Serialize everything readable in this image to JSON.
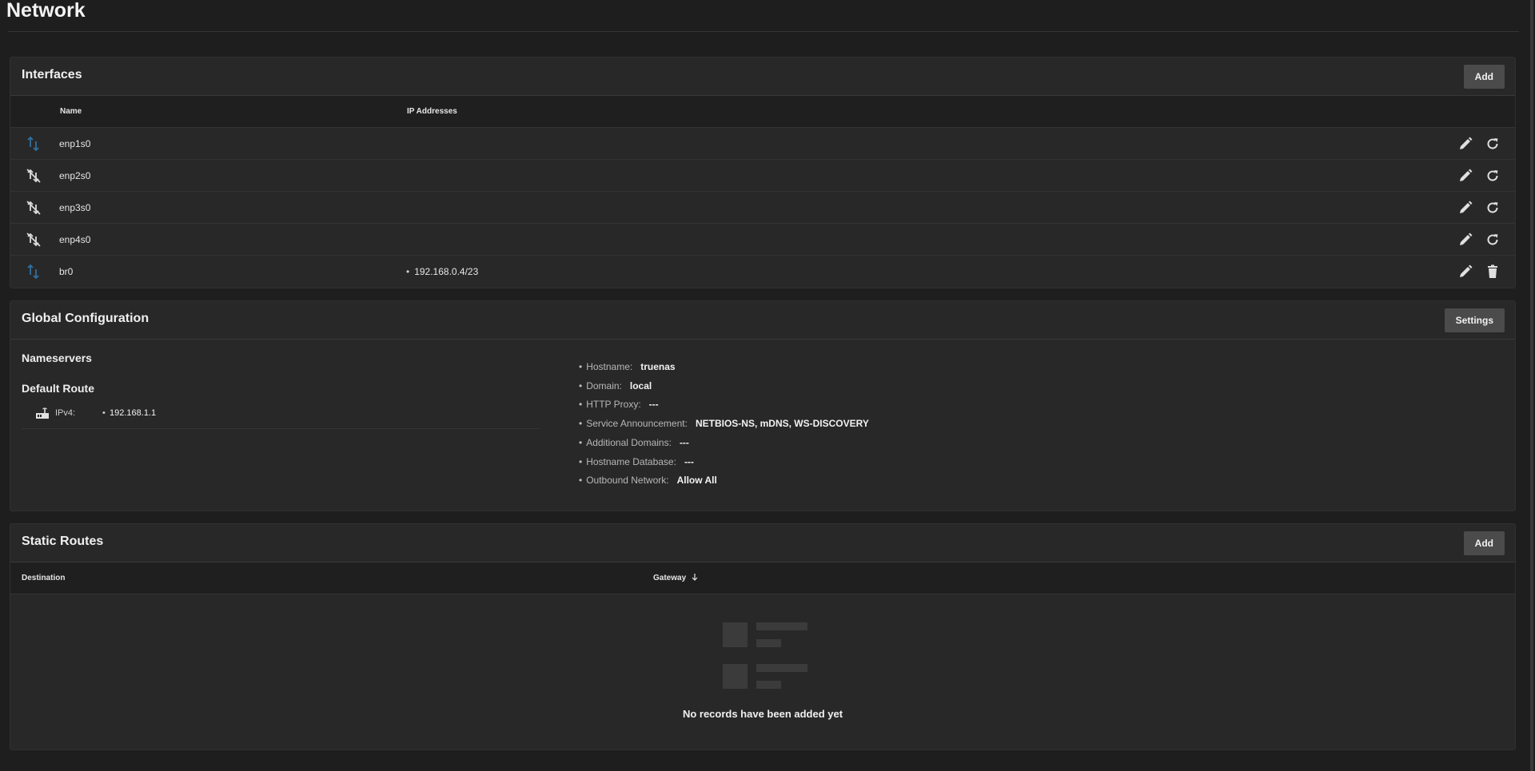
{
  "page": {
    "title": "Network"
  },
  "interfaces": {
    "title": "Interfaces",
    "add_label": "Add",
    "columns": {
      "name": "Name",
      "ip": "IP Addresses"
    },
    "rows": [
      {
        "name": "enp1s0",
        "ip": "",
        "status": "link-up-icon",
        "action2": "refresh-icon"
      },
      {
        "name": "enp2s0",
        "ip": "",
        "status": "link-down-icon",
        "action2": "refresh-icon"
      },
      {
        "name": "enp3s0",
        "ip": "",
        "status": "link-down-icon",
        "action2": "refresh-icon"
      },
      {
        "name": "enp4s0",
        "ip": "",
        "status": "link-down-icon",
        "action2": "refresh-icon"
      },
      {
        "name": "br0",
        "ip": "192.168.0.4/23",
        "status": "link-up-icon",
        "action2": "delete-icon"
      }
    ]
  },
  "global_config": {
    "title": "Global Configuration",
    "settings_label": "Settings",
    "nameservers_title": "Nameservers",
    "default_route_title": "Default Route",
    "ipv4_label": "IPv4:",
    "ipv4_value": "192.168.1.1",
    "details": {
      "hostname": {
        "label": "Hostname:",
        "value": "truenas"
      },
      "domain": {
        "label": "Domain:",
        "value": "local"
      },
      "http_proxy": {
        "label": "HTTP Proxy:",
        "value": "---"
      },
      "service_announcement": {
        "label": "Service Announcement:",
        "value": "NETBIOS-NS, mDNS, WS-DISCOVERY"
      },
      "additional_domains": {
        "label": "Additional Domains:",
        "value": "---"
      },
      "hostname_database": {
        "label": "Hostname Database:",
        "value": "---"
      },
      "outbound_network": {
        "label": "Outbound Network:",
        "value": "Allow All"
      }
    }
  },
  "static_routes": {
    "title": "Static Routes",
    "add_label": "Add",
    "columns": {
      "destination": "Destination",
      "gateway": "Gateway"
    },
    "empty_text": "No records have been added yet"
  },
  "colors": {
    "background": "#1e1e1e",
    "card": "#282828",
    "link_up": "#2f6f9f",
    "button": "#4b4b4b"
  }
}
